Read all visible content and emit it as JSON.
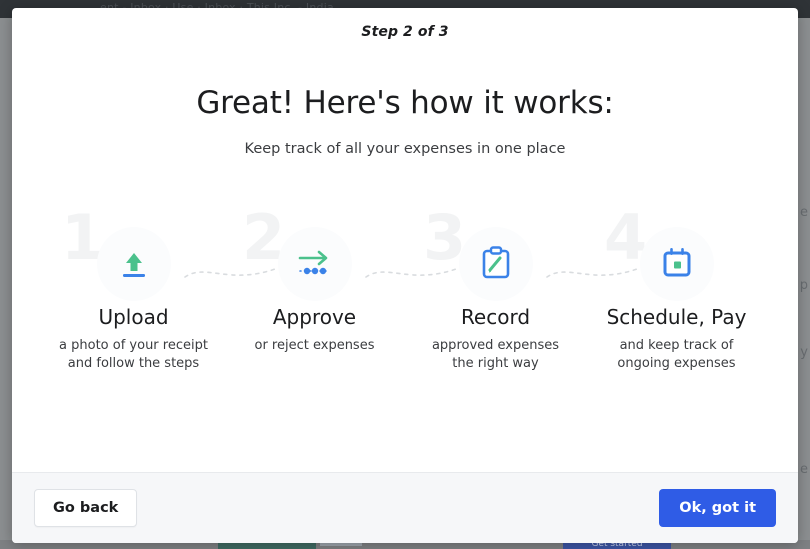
{
  "backdrop": {
    "topbar_text": "ent  -  Inbox  ·  Use  ·  Inbox  ·  This Inc. - India",
    "line1": "e",
    "line2": "p",
    "line3": "y",
    "line4": "e",
    "get_started_label": "Get started"
  },
  "modal": {
    "step_indicator": "Step 2 of 3",
    "headline": "Great! Here's how it works:",
    "subhead": "Keep track of all your expenses in one place",
    "steps": [
      {
        "number": "1",
        "icon": "upload-icon",
        "title": "Upload",
        "description": "a photo of your receipt and follow the steps"
      },
      {
        "number": "2",
        "icon": "arrow-right-approve-icon",
        "title": "Approve",
        "description": "or reject expenses"
      },
      {
        "number": "3",
        "icon": "clipboard-pencil-icon",
        "title": "Record",
        "description": "approved expenses the right way"
      },
      {
        "number": "4",
        "icon": "calendar-icon",
        "title": "Schedule, Pay",
        "description": "and keep track of ongoing expenses"
      }
    ],
    "footer": {
      "back_label": "Go back",
      "confirm_label": "Ok, got it"
    }
  },
  "colors": {
    "primary_blue": "#2f5ce6",
    "icon_blue": "#3b82e8",
    "icon_green": "#4bc18c",
    "ghost_number": "#f2f3f4",
    "footer_bg": "#f6f7f9",
    "text_dark": "#1c1d1f"
  }
}
